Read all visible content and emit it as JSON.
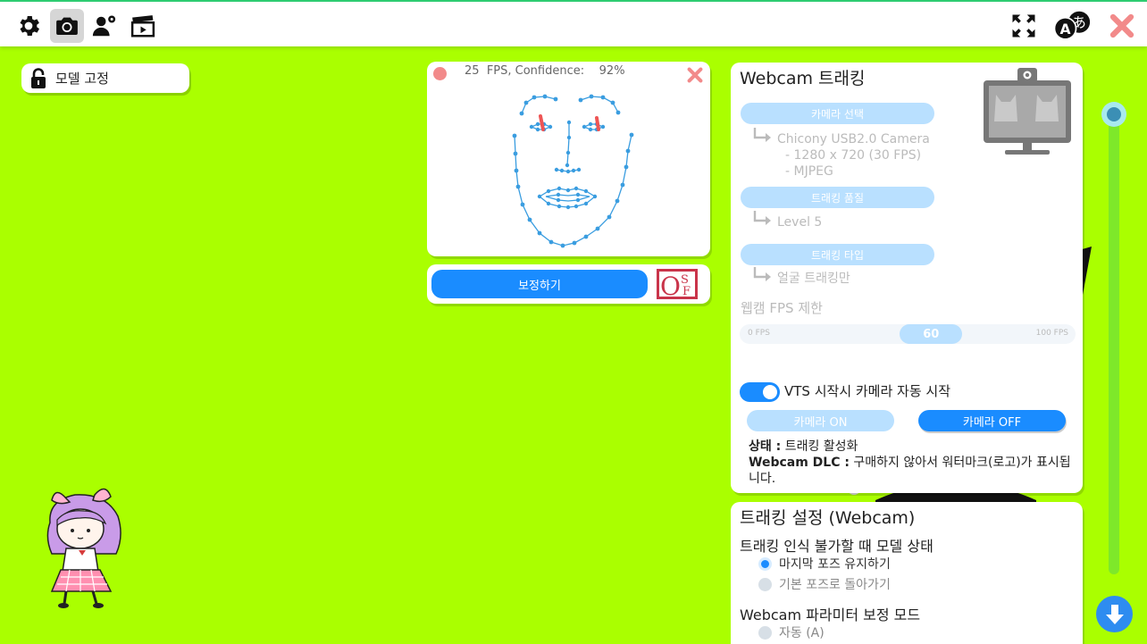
{
  "toolbar": {
    "left_icons": [
      "gear-icon",
      "camera-icon",
      "user-settings-icon",
      "clapperboard-icon"
    ],
    "right_icons": [
      "fullscreen-icon",
      "language-icon",
      "close-icon"
    ],
    "active_icon": "camera-icon"
  },
  "model_lock": {
    "label": "모델 고정"
  },
  "face_preview": {
    "fps": "25",
    "fps_unit": "FPS, Confidence:",
    "confidence": "92%"
  },
  "calibration": {
    "button_label": "보정하기",
    "logo_text": "OSF"
  },
  "webcam": {
    "title": "Webcam 트래킹",
    "camera_select_label": "카메라 선택",
    "camera_name": "Chicony USB2.0 Camera",
    "camera_resolution": "- 1280 x 720 (30 FPS)",
    "camera_format": "- MJPEG",
    "quality_label": "트래킹 품질",
    "quality_value": "Level 5",
    "type_label": "트래킹 타입",
    "type_value": "얼굴 트래킹만",
    "fps_limit_label": "웹캠 FPS 제한",
    "fps_min": "0 FPS",
    "fps_max": "100 FPS",
    "fps_value": "60",
    "fps_fraction": 0.57,
    "autostart_label": "VTS 시작시 카메라 자동 시작",
    "autostart_on": true,
    "camera_on_label": "카메라 ON",
    "camera_off_label": "카메라 OFF",
    "status_key": "상태 :",
    "status_value": "트래킹 활성화",
    "dlc_key": "Webcam DLC :",
    "dlc_value": "구매하지 않아서 워터마크(로고)가 표시됩니다."
  },
  "tracking_settings": {
    "title": "트래킹 설정 (Webcam)",
    "lost_heading": "트래킹 인식 불가할 때 모델 상태",
    "lost_options": [
      "마지막 포즈 유지하기",
      "기본 포즈로 돌아가기"
    ],
    "lost_selected": 0,
    "param_heading": "Webcam 파라미터 보정 모드",
    "param_options": [
      "자동 (A)"
    ]
  },
  "colors": {
    "background": "#aaff00",
    "accent": "#1a8cff",
    "accent_light": "#b9e0ff",
    "close_red": "#f28a8a"
  }
}
